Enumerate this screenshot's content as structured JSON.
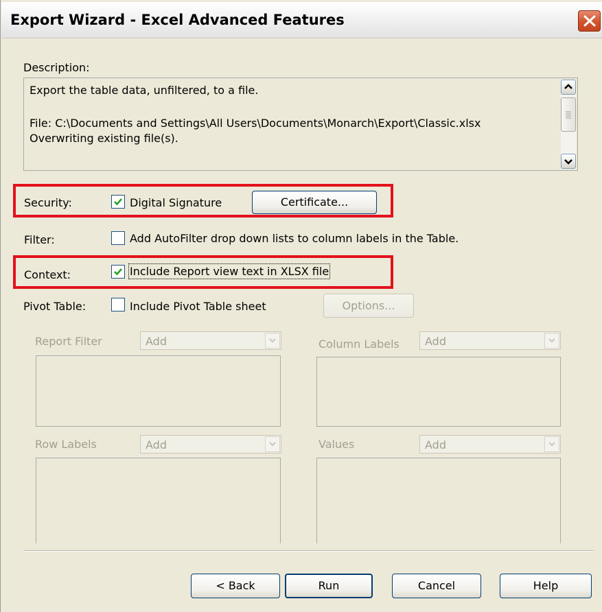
{
  "window": {
    "title": "Export Wizard - Excel Advanced Features"
  },
  "description": {
    "label": "Description:",
    "lines": [
      "Export the table data, unfiltered, to a file.",
      "File: C:\\Documents and Settings\\All Users\\Documents\\Monarch\\Export\\Classic.xlsx",
      "Overwriting existing file(s)."
    ]
  },
  "security": {
    "label": "Security:",
    "checkbox_label": "Digital Signature",
    "checked": true,
    "certificate_button": "Certificate..."
  },
  "filter": {
    "label": "Filter:",
    "checkbox_label": "Add AutoFilter drop down lists to column labels in the Table.",
    "checked": false
  },
  "context": {
    "label": "Context:",
    "checkbox_label": "Include Report view text in XLSX file",
    "checked": true
  },
  "pivot": {
    "label": "Pivot Table:",
    "checkbox_label": "Include Pivot Table sheet",
    "checked": false,
    "options_button": "Options...",
    "report_filter": {
      "label": "Report Filter",
      "combo_value": "Add"
    },
    "column_labels": {
      "label": "Column Labels",
      "combo_value": "Add"
    },
    "row_labels": {
      "label": "Row Labels",
      "combo_value": "Add"
    },
    "values": {
      "label": "Values",
      "combo_value": "Add"
    }
  },
  "buttons": {
    "back": "< Back",
    "run": "Run",
    "cancel": "Cancel",
    "help": "Help"
  },
  "colors": {
    "highlight_red": "#e3111c",
    "dialog_bg": "#ece9d8",
    "checkmark_green": "#21a121"
  }
}
